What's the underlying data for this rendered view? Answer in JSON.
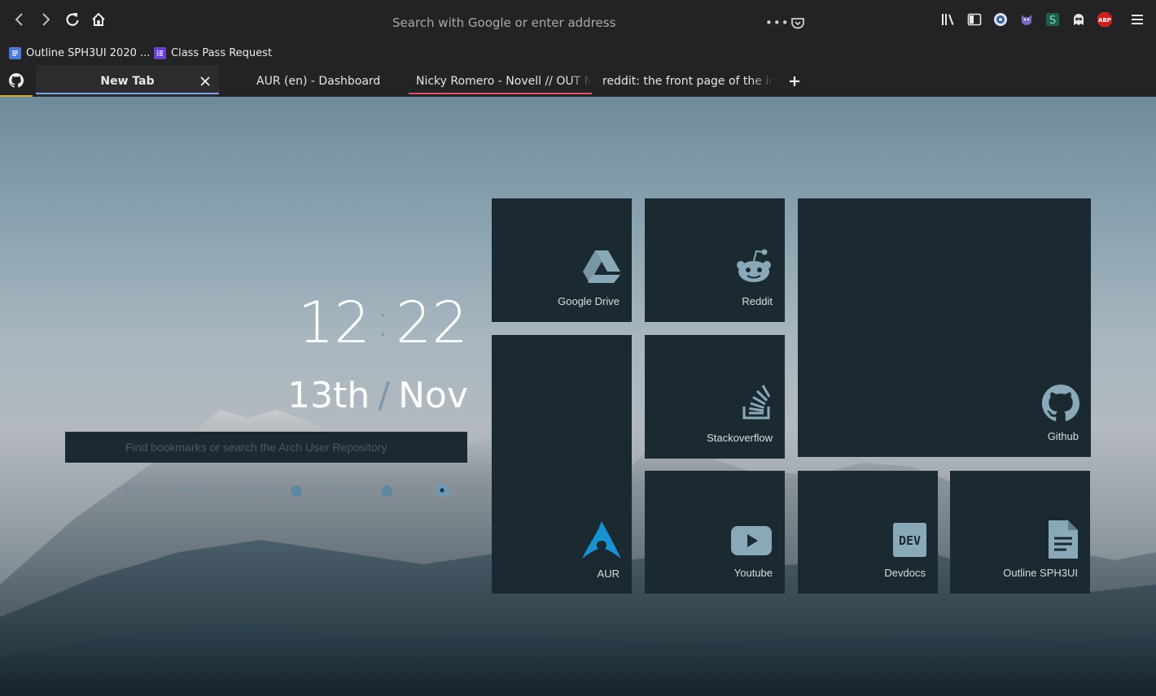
{
  "toolbar": {
    "url_placeholder": "Search with Google or enter address",
    "page_actions_label": "•••"
  },
  "extensions": [
    {
      "name": "library-icon"
    },
    {
      "name": "sidebar-icon"
    },
    {
      "name": "extension-globe-icon"
    },
    {
      "name": "extension-octocat-icon"
    },
    {
      "name": "extension-s-icon"
    },
    {
      "name": "extension-ghost-icon"
    },
    {
      "name": "adblock-plus-icon",
      "label": "ABP"
    }
  ],
  "bookmarks": [
    {
      "label": "Outline SPH3UI 2020 ...",
      "color": "#4a7bd6"
    },
    {
      "label": "Class Pass Request",
      "color": "#6b3fd1"
    }
  ],
  "tabs": [
    {
      "label": "New Tab",
      "active": true,
      "underline": "#7fa2e6"
    },
    {
      "label": "AUR (en) - Dashboard"
    },
    {
      "label": "Nicky Romero - Novell // OUT N",
      "underline": "#e0506a"
    },
    {
      "label": "reddit: the front page of the inte"
    }
  ],
  "clock": {
    "hours": "12",
    "separator": ":",
    "minutes": "22"
  },
  "date": {
    "day": "13th",
    "separator": "/",
    "month": "Nov"
  },
  "search": {
    "placeholder": "Find bookmarks or search the Arch User Repository"
  },
  "controls": {
    "edit": "Edit",
    "add": "Add",
    "colour": "Colour",
    "accent": "Accent"
  },
  "tiles": {
    "google_drive": "Google Drive",
    "reddit": "Reddit",
    "github": "Github",
    "aur": "AUR",
    "stackoverflow": "Stackoverflow",
    "youtube": "Youtube",
    "devdocs": "Devdocs",
    "outline": "Outline SPH3UI"
  },
  "colors": {
    "tile_bg": "#1b2a31",
    "accent": "#5e87a0",
    "icon": "#8aa9b8",
    "aur_blue": "#1793d1"
  }
}
